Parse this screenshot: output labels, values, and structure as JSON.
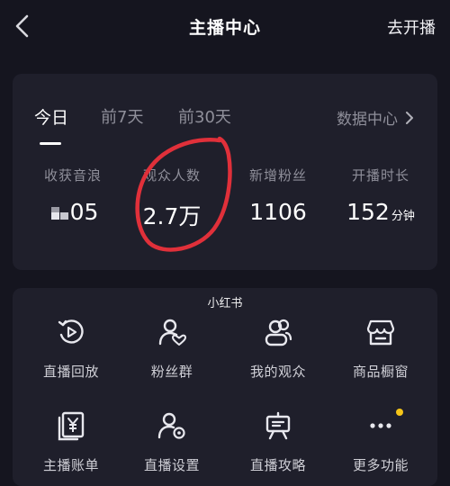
{
  "header": {
    "title": "主播中心",
    "go_live_label": "去开播"
  },
  "stats": {
    "tabs": [
      {
        "label": "今日",
        "active": true
      },
      {
        "label": "前7天",
        "active": false
      },
      {
        "label": "前30天",
        "active": false
      }
    ],
    "data_center_label": "数据中心",
    "items": [
      {
        "label": "收获音浪",
        "value": "05",
        "obscured": true
      },
      {
        "label": "观众人数",
        "value": "2.7万"
      },
      {
        "label": "新增粉丝",
        "value": "1106"
      },
      {
        "label": "开播时长",
        "value": "152",
        "unit": "分钟"
      }
    ],
    "annotation_color": "#e0303a"
  },
  "tools": {
    "watermark": "小红书",
    "items": [
      {
        "label": "直播回放",
        "icon": "play-circle-icon"
      },
      {
        "label": "粉丝群",
        "icon": "fans-group-icon"
      },
      {
        "label": "我的观众",
        "icon": "audience-icon"
      },
      {
        "label": "商品橱窗",
        "icon": "storefront-icon"
      },
      {
        "label": "主播账单",
        "icon": "bill-icon"
      },
      {
        "label": "直播设置",
        "icon": "settings-user-icon"
      },
      {
        "label": "直播攻略",
        "icon": "guide-icon"
      },
      {
        "label": "更多功能",
        "icon": "more-icon",
        "badge": true
      }
    ],
    "badge_color": "#f5c518"
  }
}
